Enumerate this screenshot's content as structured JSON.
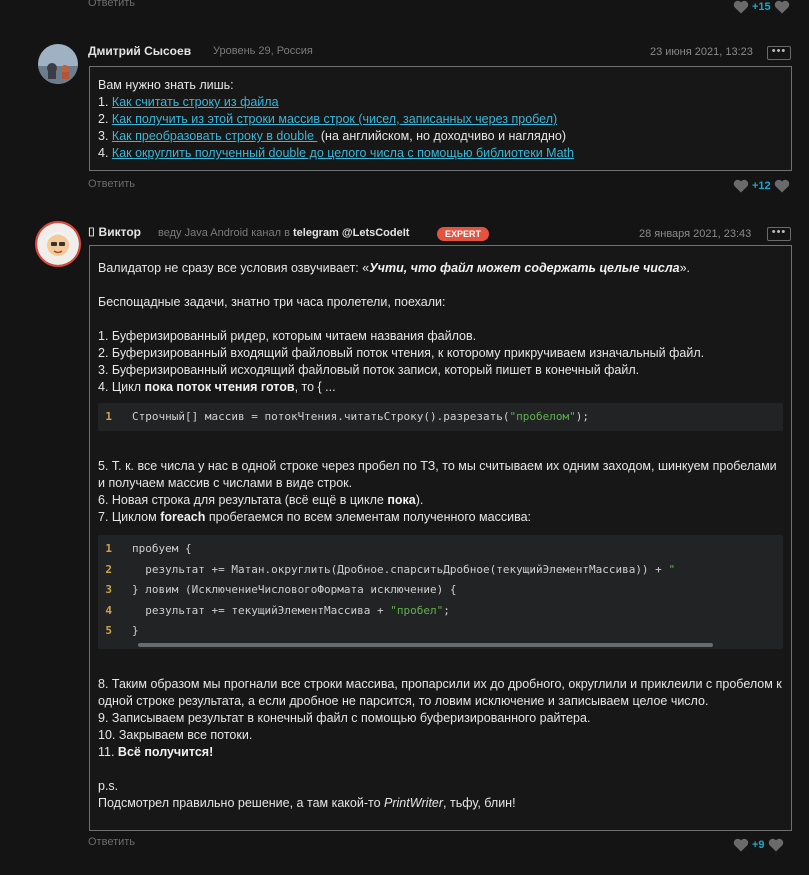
{
  "top": {
    "reply_label": "Ответить",
    "likes": "+15"
  },
  "comment1": {
    "author": "Дмитрий Сысоев",
    "meta": "Уровень 29, Россия",
    "date": "23 июня 2021, 13:23",
    "more": "•••",
    "intro": "Вам нужно знать лишь:",
    "items": [
      {
        "num": "1.",
        "link": "Как считать строку из файла",
        "tail": ""
      },
      {
        "num": "2.",
        "link": "Как получить из этой строки массив строк (чисел, записанных через пробел)",
        "tail": ""
      },
      {
        "num": "3.",
        "link": "Как преобразовать строку в double ",
        "tail": " (на английском, но доходчиво и наглядно)"
      },
      {
        "num": "4.",
        "link": "Как округлить полученный double до целого числа с помощью библиотеки Math",
        "tail": ""
      }
    ],
    "reply_label": "Ответить",
    "likes": "+12"
  },
  "comment2": {
    "icon_prefix": "⌷",
    "author": "Виктор",
    "meta_pre": "веду Java Android канал в",
    "meta_link": "telegram @LetsCodeIt",
    "badge": "EXPERT",
    "date": "28 января 2021, 23:43",
    "more": "•••",
    "p1_pre": "Валидатор не сразу все условия озвучивает: «",
    "p1_italic": "Учти, что файл может содержать целые числа",
    "p1_post": "».",
    "p2": "Беспощадные задачи, знатно три часа пролетели, поехали:",
    "list1": [
      "1. Буферизированный ридер, которым читаем названия файлов.",
      "2. Буферизированный входящий файловый поток чтения, к которому прикручиваем изначальный файл.",
      "3. Буферизированный исходящий файловый поток записи, который пишет в конечный файл."
    ],
    "l4_pre": "4. Цикл ",
    "l4_bold": "пока поток чтения готов",
    "l4_post": ", то { ...",
    "code1": {
      "line_no": "1",
      "code_pre": "Строчный[] массив = потокЧтения.читатьСтроку().разрезать(",
      "code_str": "\"пробелом\"",
      "code_post": ");"
    },
    "l5": "5. Т. к. все числа у нас в одной строке через пробел по ТЗ, то мы считываем их одним заходом, шинкуем пробелами и получаем массив с числами в виде строк.",
    "l6_pre": "6. Новая строка для результата (всё ещё в цикле ",
    "l6_bold": "пока",
    "l6_post": ").",
    "l7_pre": "7. Циклом ",
    "l7_bold": "foreach",
    "l7_post": " пробегаемся по всем элементам полученного массива:",
    "code2": [
      {
        "n": "1",
        "pre": "пробуем {",
        "str": "",
        "post": ""
      },
      {
        "n": "2",
        "pre": "  результат += Матан.округлить(Дробное.спарситьДробное(текущийЭлементМассива)) + ",
        "str": "\"",
        "post": ""
      },
      {
        "n": "3",
        "pre": "} ловим (ИсключениеЧисловогоФормата исключение) {",
        "str": "",
        "post": ""
      },
      {
        "n": "4",
        "pre": "  результат += текущийЭлементМассива + ",
        "str": "\"пробел\"",
        "post": ";"
      },
      {
        "n": "5",
        "pre": "}",
        "str": "",
        "post": ""
      }
    ],
    "l8": "8. Таким образом мы прогнали все строки массива, пропарсили их до дробного, округлили и приклеили с пробелом к одной строке результата, а если дробное не парсится, то ловим исключение и записываем целое число.",
    "l9": "9. Записываем результат в конечный файл с помощью буферизированного райтера.",
    "l10": "10. Закрываем все потоки.",
    "l11_pre": "11. ",
    "l11_bold": "Всё получится!",
    "ps": "p.s.",
    "last_pre": "Подсмотрел правильно решение, а там какой-то ",
    "last_italic": "PrintWriter",
    "last_post": ", тьфу, блин!",
    "reply_label": "Ответить",
    "likes": "+9"
  }
}
